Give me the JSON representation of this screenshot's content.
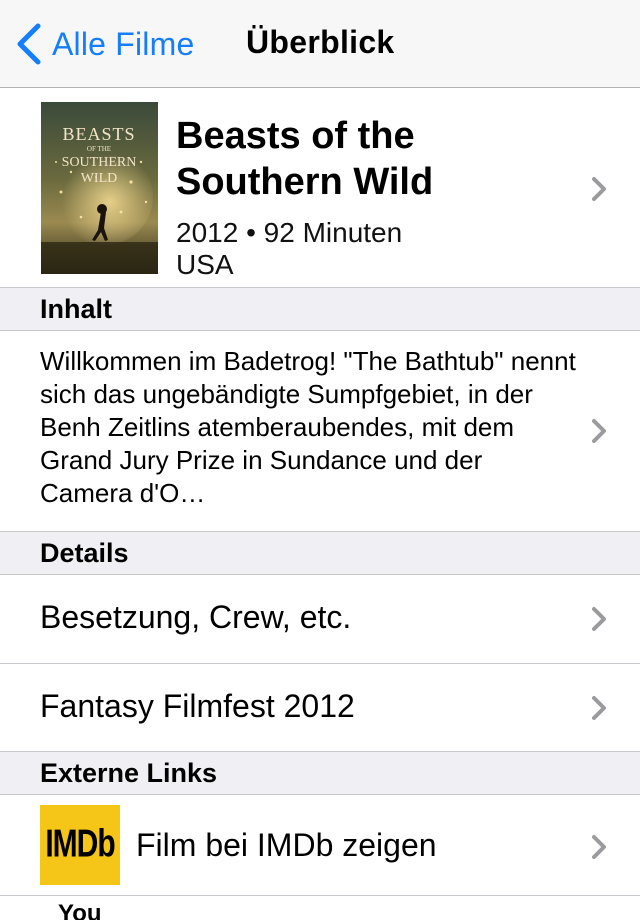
{
  "navbar": {
    "back_label": "Alle Filme",
    "title": "Überblick"
  },
  "movie": {
    "title_line1": "Beasts of the",
    "title_line2": "Southern Wild",
    "meta": "2012 • 92 Minuten",
    "country": "USA",
    "poster": {
      "title_top": "BEASTS",
      "title_mid": "OF THE",
      "title_south": "SOUTHERN",
      "title_wild": "WILD"
    }
  },
  "sections": {
    "inhalt": "Inhalt",
    "details": "Details",
    "links": "Externe Links"
  },
  "inhalt_text": "Willkommen im Badetrog! \"The Bathtub\" nennt sich das ungebändigte Sumpfgebiet, in der Benh Zeitlins atemberaubendes, mit dem Grand Jury Prize in Sundance und der Camera d'O…",
  "details_rows": {
    "cast": "Besetzung, Crew, etc.",
    "festival": "Fantasy Filmfest 2012"
  },
  "links_rows": {
    "imdb_logo": "IMDb",
    "imdb": "Film bei IMDb zeigen"
  },
  "peek_text": "You",
  "colors": {
    "accent": "#147efb",
    "imdb": "#f5c518",
    "section_bg": "#efeff4"
  }
}
